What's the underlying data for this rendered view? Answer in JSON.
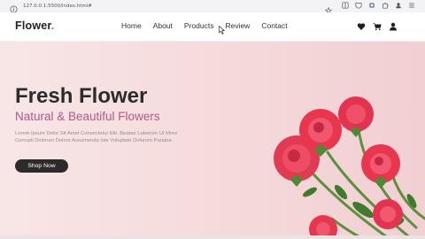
{
  "browser": {
    "url": "127.0.0.1:5500/index.html#",
    "icons": [
      "info-icon",
      "star-icon",
      "reader-icon",
      "pocket-icon",
      "extension-icon",
      "profile-icon",
      "menu-icon"
    ]
  },
  "header": {
    "logo": "Flower",
    "logo_dot": ".",
    "nav": [
      "Home",
      "About",
      "Products",
      "Review",
      "Contact"
    ],
    "icons": [
      "heart-icon",
      "cart-icon",
      "user-icon"
    ]
  },
  "hero": {
    "title": "Fresh Flower",
    "subtitle": "Natural & Beautiful Flowers",
    "text": "Lorem Ipsum Dolor Sit Amet Consectetur Elit. Beatae Laborum Ut Mnre Corrupti Dolorum Dolore Assumenda Iste Voluptate Dolorem Pariatur.",
    "button": "Shop Now"
  },
  "colors": {
    "accent": "#b0588b",
    "logo_dot": "#e04e7b",
    "button_bg": "#2d2a2b",
    "hero_bg": "#f6dcdd",
    "rose": "#e8364f"
  }
}
